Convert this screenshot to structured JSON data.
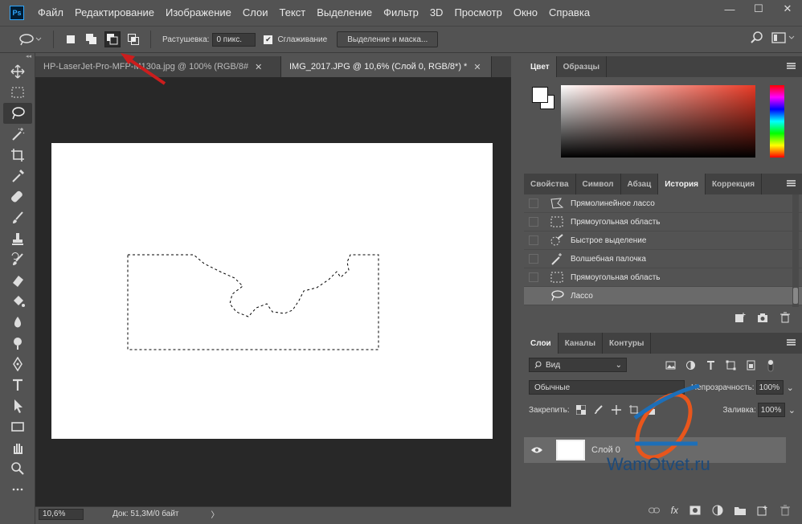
{
  "app": {
    "logo": "Ps"
  },
  "menu": [
    "Файл",
    "Редактирование",
    "Изображение",
    "Слои",
    "Текст",
    "Выделение",
    "Фильтр",
    "3D",
    "Просмотр",
    "Окно",
    "Справка"
  ],
  "window_controls": {
    "minimize": "—",
    "maximize": "☐",
    "close": "✕"
  },
  "options": {
    "feather_label": "Растушевка:",
    "feather_value": "0 пикс.",
    "antialias_label": "Сглаживание",
    "select_mask_button": "Выделение и маска..."
  },
  "tabs": [
    {
      "label": "HP-LaserJet-Pro-MFP-M130a.jpg @ 100% (RGB/8#",
      "close": "✕"
    },
    {
      "label": "IMG_2017.JPG @ 10,6% (Слой 0, RGB/8*) *",
      "close": "✕"
    }
  ],
  "status": {
    "zoom": "10,6%",
    "doc": "Док: 51,3M/0 байт",
    "arrow": "〉"
  },
  "color_panel": {
    "tabs": [
      "Цвет",
      "Образцы"
    ]
  },
  "history_panel": {
    "tabs": [
      "Свойства",
      "Символ",
      "Абзац",
      "История",
      "Коррекция"
    ],
    "items": [
      {
        "label": "Прямолинейное лассо",
        "icon": "polygonal-lasso-icon"
      },
      {
        "label": "Прямоугольная область",
        "icon": "rect-marquee-icon"
      },
      {
        "label": "Быстрое выделение",
        "icon": "quick-select-icon"
      },
      {
        "label": "Волшебная палочка",
        "icon": "magic-wand-icon"
      },
      {
        "label": "Прямоугольная область",
        "icon": "rect-marquee-icon"
      },
      {
        "label": "Лассо",
        "icon": "lasso-icon",
        "selected": true
      }
    ]
  },
  "layers_panel": {
    "tabs": [
      "Слои",
      "Каналы",
      "Контуры"
    ],
    "kind_filter": "Вид",
    "blend_mode": "Обычные",
    "opacity_label": "Непрозрачность:",
    "opacity_value": "100%",
    "lock_label": "Закрепить:",
    "fill_label": "Заливка:",
    "fill_value": "100%",
    "layers": [
      {
        "name": "Слой 0",
        "visible": true
      }
    ]
  },
  "watermark": "WamOtvet.ru",
  "colors": {
    "accent": "#cc1d1d",
    "watermark_blue": "#1d4a7a",
    "watermark_orange": "#e8561c"
  }
}
